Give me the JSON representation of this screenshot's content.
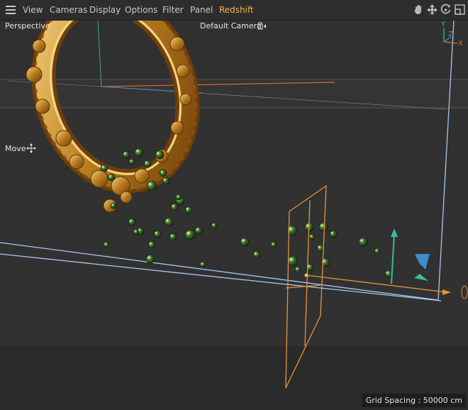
{
  "menu": {
    "items": [
      "View",
      "Cameras",
      "Display",
      "Options",
      "Filter",
      "Panel",
      "Redshift"
    ],
    "active_item": "Redshift"
  },
  "toolbar": {
    "icons": [
      "hand-pan-icon",
      "move-arrows-icon",
      "rotate-icon",
      "maximize-view-icon"
    ]
  },
  "viewport": {
    "projection_label": "Perspective",
    "camera_label": "Default Camera",
    "tool_label": "Move",
    "grid_spacing_label": "Grid Spacing : 50000 cm",
    "axis_labels": {
      "x": "X",
      "y": "Y",
      "z": "Z"
    }
  },
  "colors": {
    "accent_active": "#f0b24e",
    "background": "#2b2b2b",
    "selection_orange": "#e8923a",
    "bounding_box": "#a8c8ee",
    "gizmo_y": "#3cb8a0",
    "gizmo_z": "#3c8cd0",
    "gizmo_x": "#e0663a"
  }
}
